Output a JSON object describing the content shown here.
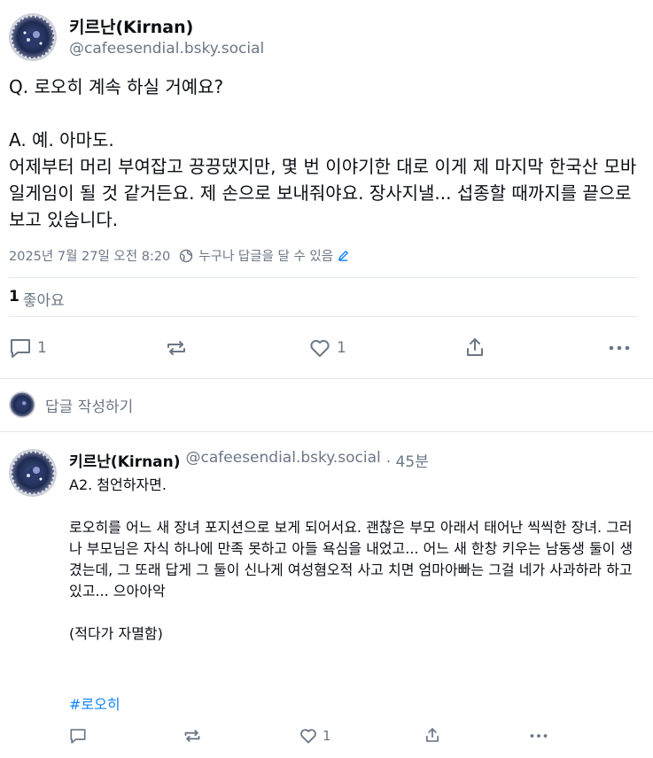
{
  "main_post": {
    "author_name": "키르난(Kirnan)",
    "author_handle": "@cafeesendial.bsky.social",
    "text": "Q. 로오히 계속 하실 거예요?\n\nA. 예. 아마도.\n어제부터 머리 부여잡고 끙끙댔지만, 몇 번 이야기한 대로 이게 제 마지막 한국산 모바일게임이 될 것 같거든요. 제 손으로 보내줘야요. 장사지낼... 섭종할 때까지를 끝으로 보고 있습니다.",
    "timestamp": "2025년 7월 27일 오전 8:20",
    "reply_permission": "누구나 답글을 달 수 있음",
    "likes_count": "1",
    "likes_label": "좋아요",
    "reply_count": "1",
    "like_count_action": "1"
  },
  "reply_composer": {
    "placeholder": "답글 작성하기"
  },
  "reply": {
    "author_name": "키르난(Kirnan)",
    "author_handle": "@cafeesendial.bsky.social",
    "time_ago": "· 45분",
    "text": "A2. 첨언하자면.\n\n로오히를 어느 새 장녀 포지션으로 보게 되어서요. 괜찮은 부모 아래서 태어난 씩씩한 장녀. 그러나 부모님은 자식 하나에 만족 못하고 아들 욕심을 내었고... 어느 새 한창 키우는 남동생 둘이 생겼는데, 그 또래 답게 그 둘이 신나게 여성혐오적 사고 치면 엄마아빠는 그걸 네가 사과하라 하고 있고... 으아아악\n\n(적다가 자멸함)",
    "hashtag": "#로오히",
    "like_count": "1"
  },
  "icons": {
    "reply": "speech-bubble-icon",
    "repost": "repost-arrows-icon",
    "like": "heart-icon",
    "share": "share-upload-icon",
    "more": "more-dots-icon",
    "globe": "globe-icon",
    "edit": "pencil-icon"
  },
  "colors": {
    "text": "#0b0f14",
    "muted": "#6b7785",
    "link": "#1083fe",
    "divider": "#e6e9ec"
  }
}
